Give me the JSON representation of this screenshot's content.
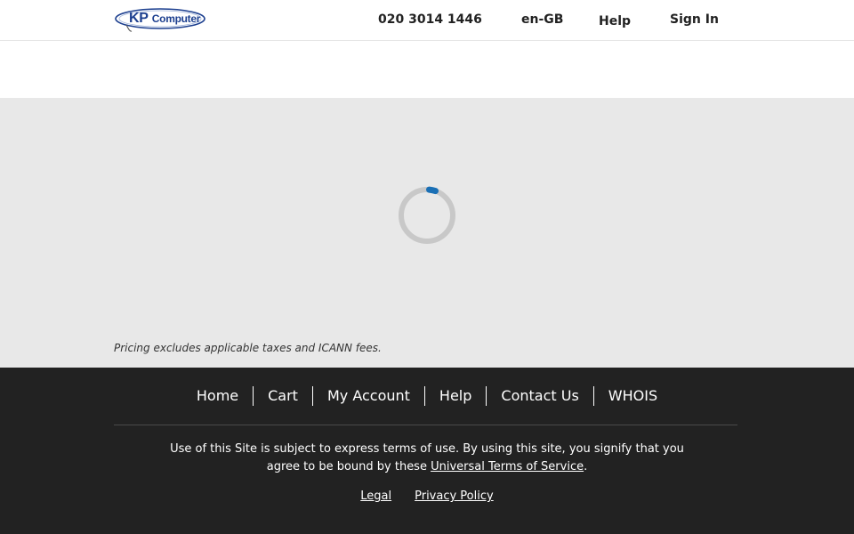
{
  "header": {
    "logo": {
      "kp": "KP",
      "computer": "Computer"
    },
    "phone": "020 3014 1446",
    "language": "en-GB",
    "help": "Help",
    "sign_in": "Sign In"
  },
  "content": {
    "loading_icon": "spinner-icon",
    "pricing_note": "Pricing excludes applicable taxes and ICANN fees."
  },
  "footer": {
    "nav": [
      "Home",
      "Cart",
      "My Account",
      "Help",
      "Contact Us",
      "WHOIS"
    ],
    "terms_text_1": "Use of this Site is subject to express terms of use. By using this site, you signify that you agree to be bound by these ",
    "terms_link": "Universal Terms of Service",
    "terms_text_2": ".",
    "legal": "Legal",
    "privacy": "Privacy Policy"
  },
  "colors": {
    "logo_blue": "#1c3f8f",
    "spinner_accent": "#1a6fb5",
    "content_bg": "#e8e8e8",
    "footer_bg": "#222222"
  }
}
